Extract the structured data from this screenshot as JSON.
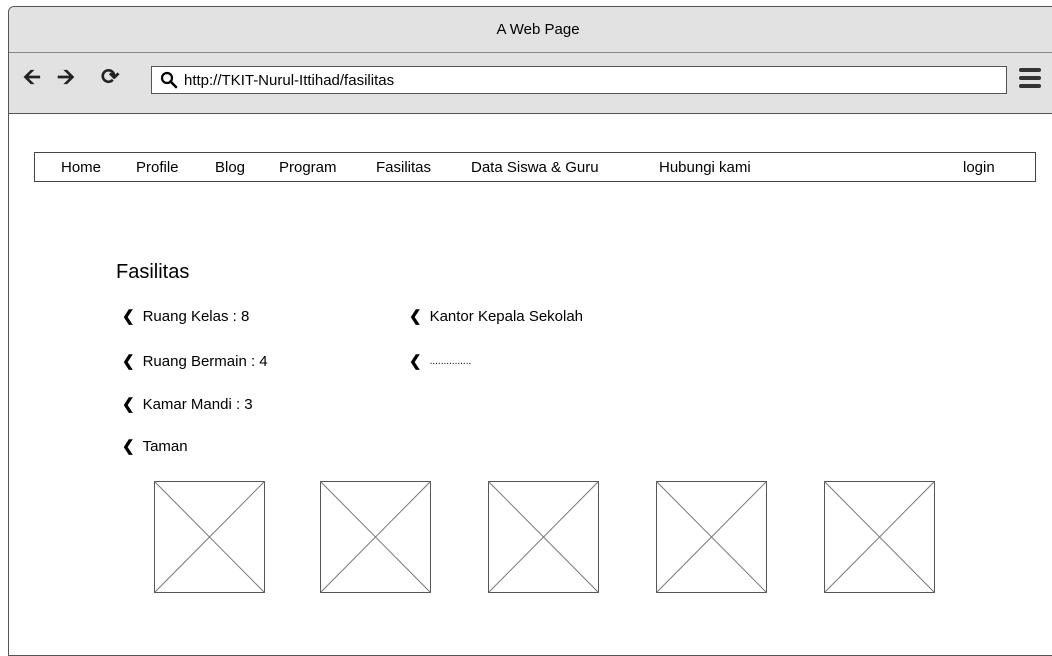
{
  "window": {
    "title": "A Web Page"
  },
  "toolbar": {
    "back_icon": "arrow-left-icon",
    "forward_icon": "arrow-right-icon",
    "reload_icon": "reload-icon",
    "url": "http://TKIT-Nurul-Ittihad/fasilitas",
    "menu_icon": "hamburger-menu-icon"
  },
  "nav": {
    "items": [
      "Home",
      "Profile",
      "Blog",
      "Program",
      "Fasilitas",
      "Data Siswa & Guru",
      "Hubungi kami"
    ],
    "login": "login"
  },
  "content": {
    "heading": "Fasilitas",
    "left_items": [
      "Ruang Kelas : 8",
      "Ruang Bermain : 4",
      "Kamar Mandi : 3",
      "Taman"
    ],
    "right_items": [
      "Kantor Kepala Sekolah",
      "..............."
    ],
    "bullet_icon": "chevron-left-icon",
    "image_placeholders": 5
  }
}
